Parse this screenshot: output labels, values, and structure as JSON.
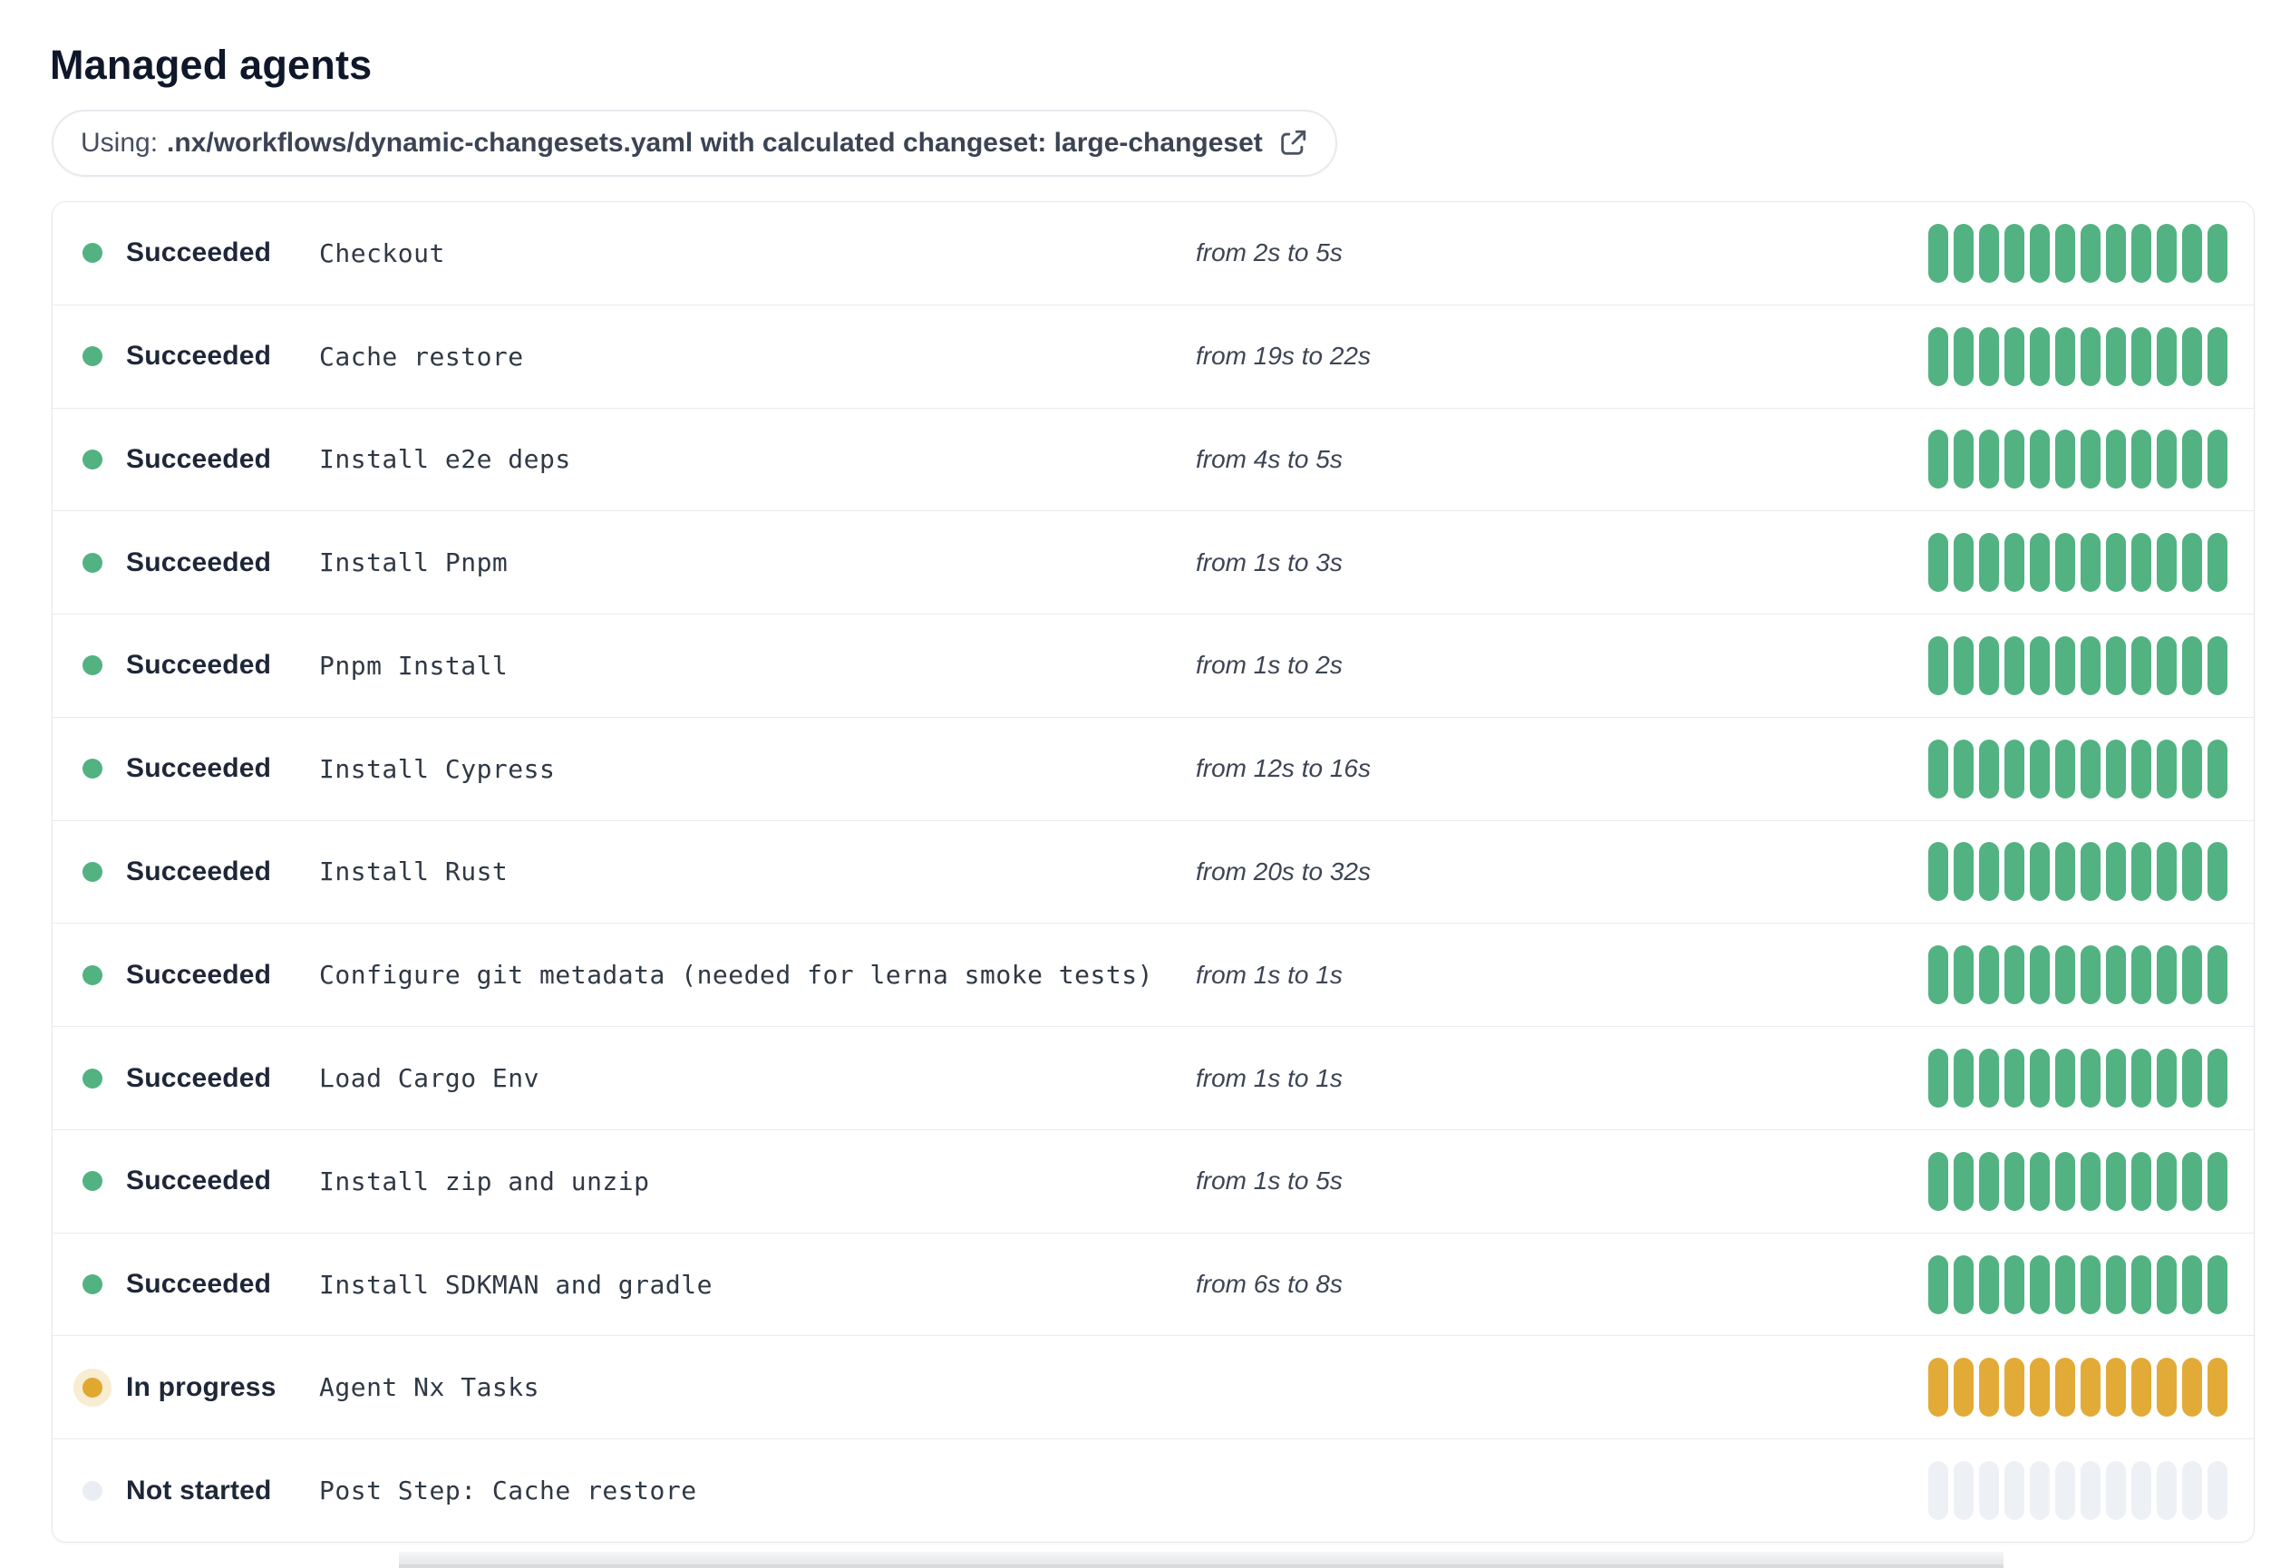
{
  "page": {
    "title": "Managed agents"
  },
  "banner": {
    "prefix": "Using:",
    "workflow": ".nx/workflows/dynamic-changesets.yaml with calculated changeset: large-changeset",
    "icon": "external-link-icon"
  },
  "colors": {
    "succeeded": "#52b282",
    "in_progress": "#e2ab38",
    "in_progress_dot": "#e0a82f",
    "in_progress_halo": "rgba(224,168,47,0.22)",
    "not_started": "#edf1f6",
    "not_started_dot": "#e9eef4"
  },
  "agents": {
    "segments_per_row": 12,
    "rows": [
      {
        "status": "Succeeded",
        "status_key": "succeeded",
        "step": "Checkout",
        "duration": "from 2s to 5s"
      },
      {
        "status": "Succeeded",
        "status_key": "succeeded",
        "step": "Cache restore",
        "duration": "from 19s to 22s"
      },
      {
        "status": "Succeeded",
        "status_key": "succeeded",
        "step": "Install e2e deps",
        "duration": "from 4s to 5s"
      },
      {
        "status": "Succeeded",
        "status_key": "succeeded",
        "step": "Install Pnpm",
        "duration": "from 1s to 3s"
      },
      {
        "status": "Succeeded",
        "status_key": "succeeded",
        "step": "Pnpm Install",
        "duration": "from 1s to 2s"
      },
      {
        "status": "Succeeded",
        "status_key": "succeeded",
        "step": "Install Cypress",
        "duration": "from 12s to 16s"
      },
      {
        "status": "Succeeded",
        "status_key": "succeeded",
        "step": "Install Rust",
        "duration": "from 20s to 32s"
      },
      {
        "status": "Succeeded",
        "status_key": "succeeded",
        "step": "Configure git metadata (needed for lerna smoke tests)",
        "duration": "from 1s to 1s"
      },
      {
        "status": "Succeeded",
        "status_key": "succeeded",
        "step": "Load Cargo Env",
        "duration": "from 1s to 1s"
      },
      {
        "status": "Succeeded",
        "status_key": "succeeded",
        "step": "Install zip and unzip",
        "duration": "from 1s to 5s"
      },
      {
        "status": "Succeeded",
        "status_key": "succeeded",
        "step": "Install SDKMAN and gradle",
        "duration": "from 6s to 8s"
      },
      {
        "status": "In progress",
        "status_key": "in-progress",
        "step": "Agent Nx Tasks",
        "duration": ""
      },
      {
        "status": "Not started",
        "status_key": "not-started",
        "step": "Post Step: Cache restore",
        "duration": ""
      }
    ]
  }
}
